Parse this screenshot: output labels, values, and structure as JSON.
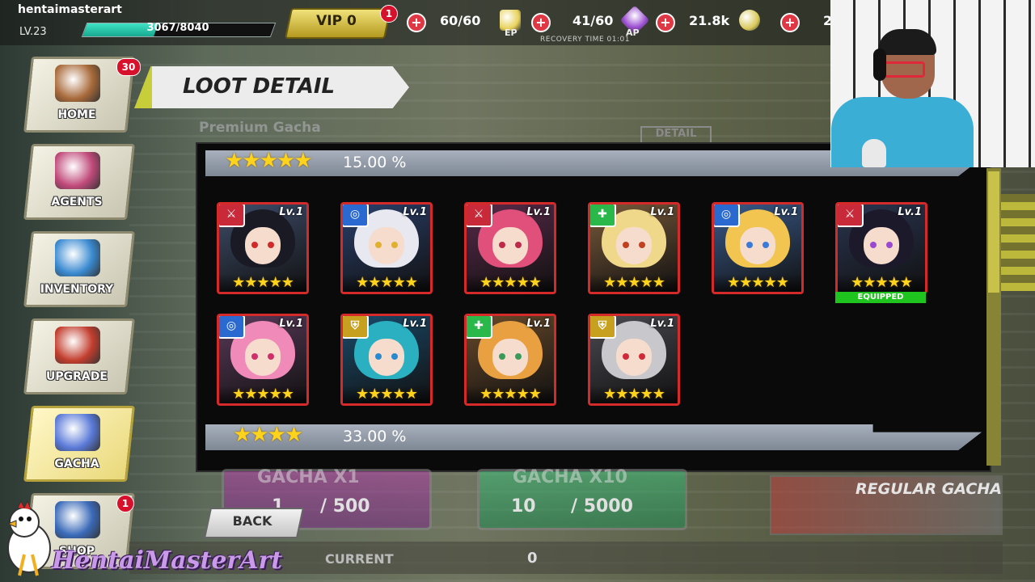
{
  "player": {
    "username": "hentaimasterart",
    "level": "LV.23",
    "xp_text": "3067/8040",
    "xp_fraction": 0.381
  },
  "vip": {
    "label": "VIP 0",
    "badge": "1"
  },
  "resources": [
    {
      "value": "60/60",
      "sub": "EP",
      "icon": "ep-drink-icon",
      "color": "#e8d25a"
    },
    {
      "value": "41/60",
      "sub": "AP",
      "icon": "ap-gem-icon",
      "color": "#9c4fd2"
    },
    {
      "value": "21.8k",
      "sub": "",
      "icon": "gold-coin-icon",
      "color": "#d9c95a"
    },
    {
      "value": "2",
      "sub": "",
      "icon": "currency-icon",
      "color": "#cccccc"
    }
  ],
  "recovery": "RECOVERY TIME 01:01",
  "menu": [
    {
      "label": "HOME",
      "badge": "30",
      "art": "home-emblem-icon",
      "color": "#a86a3a"
    },
    {
      "label": "AGENTS",
      "badge": "",
      "art": "agents-group-icon",
      "color": "#c04a7a"
    },
    {
      "label": "INVENTORY",
      "badge": "",
      "art": "inventory-cards-icon",
      "color": "#3a8ad1"
    },
    {
      "label": "UPGRADE",
      "badge": "",
      "art": "upgrade-gear-icon",
      "color": "#c23e2e"
    },
    {
      "label": "GACHA",
      "badge": "",
      "art": "gacha-capsule-icon",
      "color": "#5a7ad8"
    },
    {
      "label": "SHOP",
      "badge": "1",
      "art": "shop-box-icon",
      "color": "#3a6ab8"
    }
  ],
  "loot": {
    "title": "LOOT DETAIL",
    "subtitle": "Premium Gacha",
    "detail_btn": "DETAIL",
    "tiers": [
      {
        "stars": "★★★★★",
        "rate": "15.00 %"
      },
      {
        "stars": "★★★★",
        "rate": "33.00 %"
      }
    ],
    "cards": [
      {
        "level": "Lv.1",
        "type": "attack",
        "stars": "★★★★★",
        "hair": "#1a1a24",
        "bg": "#3e4d6a",
        "eye": "#d02a2a",
        "equipped": ""
      },
      {
        "level": "Lv.1",
        "type": "target",
        "stars": "★★★★★",
        "hair": "#e8e8f0",
        "bg": "#2a3f6a",
        "eye": "#e0b030",
        "equipped": ""
      },
      {
        "level": "Lv.1",
        "type": "attack",
        "stars": "★★★★★",
        "hair": "#e0507a",
        "bg": "#5a2a4a",
        "eye": "#c02a4a",
        "equipped": ""
      },
      {
        "level": "Lv.1",
        "type": "support",
        "stars": "★★★★★",
        "hair": "#f0d88a",
        "bg": "#7a5a3a",
        "eye": "#c04020",
        "equipped": ""
      },
      {
        "level": "Lv.1",
        "type": "target",
        "stars": "★★★★★",
        "hair": "#f2c450",
        "bg": "#3a5a8a",
        "eye": "#3a7ad8",
        "equipped": ""
      },
      {
        "level": "Lv.1",
        "type": "attack",
        "stars": "★★★★★",
        "hair": "#1c1a2a",
        "bg": "#2a3550",
        "eye": "#9a4ad0",
        "equipped": "EQUIPPED"
      },
      {
        "level": "Lv.1",
        "type": "target",
        "stars": "★★★★★",
        "hair": "#f08ab8",
        "bg": "#5a3a5a",
        "eye": "#d0306a",
        "equipped": ""
      },
      {
        "level": "Lv.1",
        "type": "tank",
        "stars": "★★★★★",
        "hair": "#2ab0c0",
        "bg": "#1a4a6a",
        "eye": "#2a8ad0",
        "equipped": ""
      },
      {
        "level": "Lv.1",
        "type": "support",
        "stars": "★★★★★",
        "hair": "#e8a040",
        "bg": "#6a4a2a",
        "eye": "#3a9a5a",
        "equipped": ""
      },
      {
        "level": "Lv.1",
        "type": "tank",
        "stars": "★★★★★",
        "hair": "#c8c8cc",
        "bg": "#4a4a52",
        "eye": "#d02a3a",
        "equipped": ""
      }
    ],
    "type_colors": {
      "attack": "#c82a3a",
      "target": "#2a6ad0",
      "support": "#2ab84a",
      "tank": "#c8a020"
    },
    "type_glyphs": {
      "attack": "⚔",
      "target": "◎",
      "support": "✚",
      "tank": "⛨"
    },
    "border_color": "#d42a2a"
  },
  "gacha": {
    "x1_title": "GACHA X1",
    "x1_cost": "1",
    "x1_max": "/ 500",
    "x10_title": "GACHA X10",
    "x10_cost": "10",
    "x10_max": "/ 5000",
    "regular": "REGULAR GACHA"
  },
  "back_label": "BACK",
  "current": {
    "label": "CURRENT",
    "value": "0"
  },
  "watermark": "HentaiMasterArt"
}
